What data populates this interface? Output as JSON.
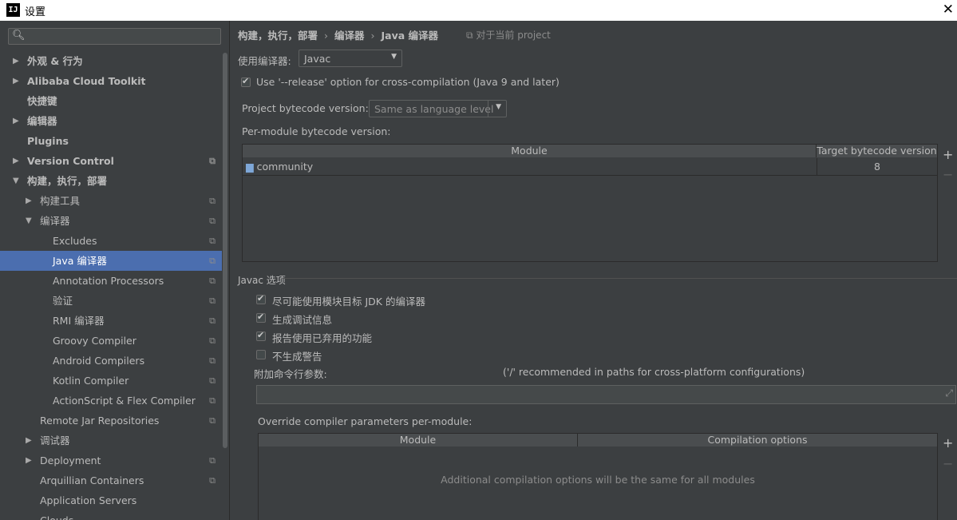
{
  "window": {
    "title": "设置",
    "app_icon": "IJ"
  },
  "sidebar": {
    "search": {
      "placeholder": ""
    },
    "items": [
      {
        "label": "外观 & 行为",
        "arrow": "▶",
        "level": 0,
        "bold": true
      },
      {
        "label": "Alibaba Cloud Toolkit",
        "arrow": "▶",
        "level": 0,
        "bold": true
      },
      {
        "label": "快捷键",
        "arrow": "",
        "level": 0,
        "bold": true
      },
      {
        "label": "编辑器",
        "arrow": "▶",
        "level": 0,
        "bold": true
      },
      {
        "label": "Plugins",
        "arrow": "",
        "level": 0,
        "bold": true
      },
      {
        "label": "Version Control",
        "arrow": "▶",
        "level": 0,
        "bold": true,
        "project": true
      },
      {
        "label": "构建，执行，部署",
        "arrow": "▼",
        "level": 0,
        "bold": true
      },
      {
        "label": "构建工具",
        "arrow": "▶",
        "level": 1,
        "project": true
      },
      {
        "label": "编译器",
        "arrow": "▼",
        "level": 1,
        "project": true
      },
      {
        "label": "Excludes",
        "arrow": "",
        "level": 2,
        "project": true
      },
      {
        "label": "Java 编译器",
        "arrow": "",
        "level": 2,
        "project": true,
        "selected": true
      },
      {
        "label": "Annotation Processors",
        "arrow": "",
        "level": 2,
        "project": true
      },
      {
        "label": "验证",
        "arrow": "",
        "level": 2,
        "project": true
      },
      {
        "label": "RMI 编译器",
        "arrow": "",
        "level": 2,
        "project": true
      },
      {
        "label": "Groovy Compiler",
        "arrow": "",
        "level": 2,
        "project": true
      },
      {
        "label": "Android Compilers",
        "arrow": "",
        "level": 2,
        "project": true
      },
      {
        "label": "Kotlin Compiler",
        "arrow": "",
        "level": 2,
        "project": true
      },
      {
        "label": "ActionScript & Flex Compiler",
        "arrow": "",
        "level": 2,
        "project": true
      },
      {
        "label": "Remote Jar Repositories",
        "arrow": "",
        "level": 1,
        "project": true
      },
      {
        "label": "调试器",
        "arrow": "▶",
        "level": 1
      },
      {
        "label": "Deployment",
        "arrow": "▶",
        "level": 1,
        "project": true
      },
      {
        "label": "Arquillian Containers",
        "arrow": "",
        "level": 1,
        "project": true
      },
      {
        "label": "Application Servers",
        "arrow": "",
        "level": 1
      },
      {
        "label": "Clouds",
        "arrow": "",
        "level": 1
      }
    ]
  },
  "content": {
    "breadcrumb": [
      "构建，执行，部署",
      "编译器",
      "Java 编译器"
    ],
    "breadcrumb_sep": "›",
    "project_note": "对于当前 project",
    "compiler": {
      "label": "使用编译器:",
      "value": "Javac"
    },
    "release_option": {
      "label": "Use '--release' option for cross-compilation (Java 9 and later)",
      "checked": true
    },
    "bytecode": {
      "label": "Project bytecode version:",
      "value": "Same as language level"
    },
    "per_module": {
      "label": "Per-module bytecode version:",
      "columns": [
        "Module",
        "Target bytecode version"
      ],
      "rows": [
        {
          "module": "community",
          "target": "8"
        }
      ]
    },
    "javac": {
      "title": "Javac 选项",
      "options": [
        {
          "label": "尽可能使用模块目标 JDK 的编译器",
          "checked": true
        },
        {
          "label": "生成调试信息",
          "checked": true
        },
        {
          "label": "报告使用已弃用的功能",
          "checked": true
        },
        {
          "label": "不生成警告",
          "checked": false
        }
      ],
      "extra_params_label": "附加命令行参数:",
      "extra_params_hint": "('/' recommended in paths for cross-platform configurations)",
      "extra_params_value": ""
    },
    "override": {
      "label": "Override compiler parameters per-module:",
      "columns": [
        "Module",
        "Compilation options"
      ],
      "empty_text": "Additional compilation options will be the same for all modules"
    },
    "add_symbol": "+",
    "remove_symbol": "−"
  },
  "colors": {
    "background": "#3c3f41",
    "selection": "#4b6eaf",
    "text": "#bbbbbb",
    "border": "#2b2b2b"
  },
  "icons": {
    "search": "search-icon",
    "project_scope": "project-scope-icon",
    "folder": "module-folder-icon",
    "expand": "expand-icon"
  }
}
